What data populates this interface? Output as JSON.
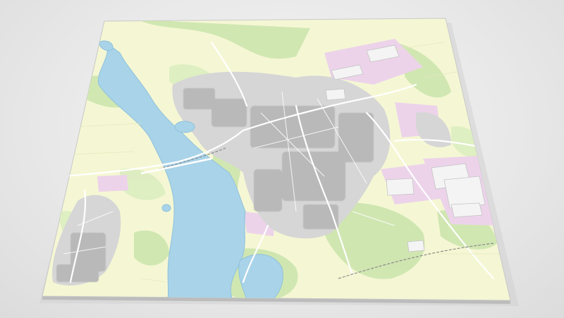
{
  "scene": {
    "type": "3d-city-map-model",
    "background_color": "#e8e8e8"
  },
  "map": {
    "labels": [],
    "colors": {
      "farmland": "#f5f7d4",
      "forest": "#cfe6b0",
      "meadow": "#dcedc0",
      "water": "#a9d3e8",
      "water_edge": "#8fc2dc",
      "urban": "#d6d6d6",
      "buildings": "#b9b9b9",
      "industrial": "#ecd3ea",
      "roads": "#ffffff",
      "rail": "#8a8a8a",
      "tile_edge": "#c9c9c9"
    }
  }
}
